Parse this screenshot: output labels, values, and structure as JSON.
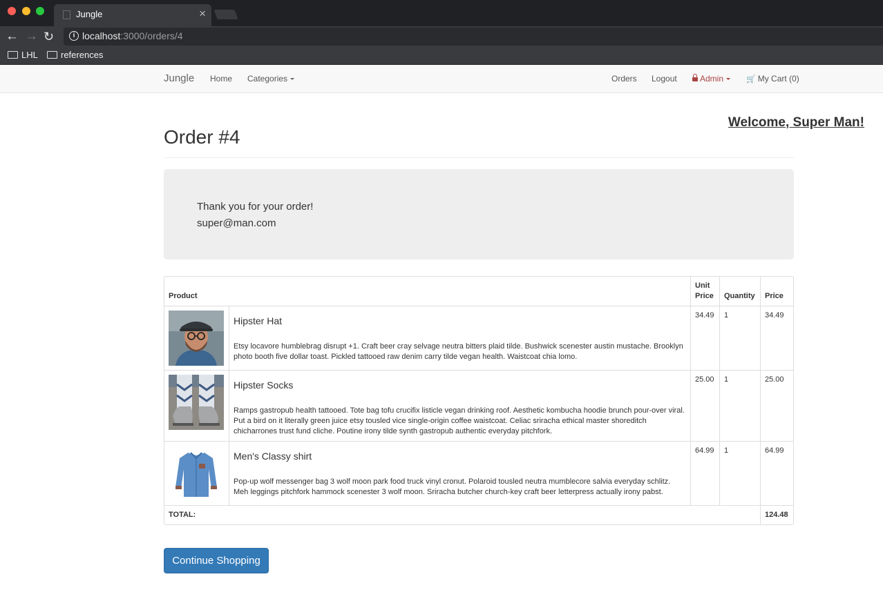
{
  "browser": {
    "tab_title": "Jungle",
    "tab_close": "×",
    "url_host": "localhost",
    "url_path": ":3000/orders/4",
    "bookmarks": [
      "LHL",
      "references"
    ]
  },
  "navbar": {
    "brand": "Jungle",
    "home": "Home",
    "categories": "Categories",
    "orders": "Orders",
    "logout": "Logout",
    "admin": "Admin",
    "cart": "My Cart (0)"
  },
  "page": {
    "welcome": "Welcome, Super Man!",
    "title": "Order #4",
    "thanks": "Thank you for your order!",
    "email": "super@man.com",
    "continue": "Continue Shopping"
  },
  "table": {
    "headers": {
      "product": "Product",
      "unit_price": "Unit Price",
      "quantity": "Quantity",
      "price": "Price"
    },
    "items": [
      {
        "name": "Hipster Hat",
        "description": "Etsy locavore humblebrag disrupt +1. Craft beer cray selvage neutra bitters plaid tilde. Bushwick scenester austin mustache. Brooklyn photo booth five dollar toast. Pickled tattooed raw denim carry tilde vegan health. Waistcoat chia lomo.",
        "unit_price": "34.49",
        "quantity": "1",
        "price": "34.49",
        "image_icon": "man-with-hat-photo"
      },
      {
        "name": "Hipster Socks",
        "description": "Ramps gastropub health tattooed. Tote bag tofu crucifix listicle vegan drinking roof. Aesthetic kombucha hoodie brunch pour-over viral. Put a bird on it literally green juice etsy tousled vice single-origin coffee waistcoat. Celiac sriracha ethical master shoreditch chicharrones trust fund cliche. Poutine irony tilde synth gastropub authentic everyday pitchfork.",
        "unit_price": "25.00",
        "quantity": "1",
        "price": "25.00",
        "image_icon": "patterned-socks-photo"
      },
      {
        "name": "Men's Classy shirt",
        "description": "Pop-up wolf messenger bag 3 wolf moon park food truck vinyl cronut. Polaroid tousled neutra mumblecore salvia everyday schlitz. Meh leggings pitchfork hammock scenester 3 wolf moon. Sriracha butcher church-key craft beer letterpress actually irony pabst.",
        "unit_price": "64.99",
        "quantity": "1",
        "price": "64.99",
        "image_icon": "denim-shirt-photo"
      }
    ],
    "total_label": "TOTAL:",
    "total_value": "124.48"
  }
}
